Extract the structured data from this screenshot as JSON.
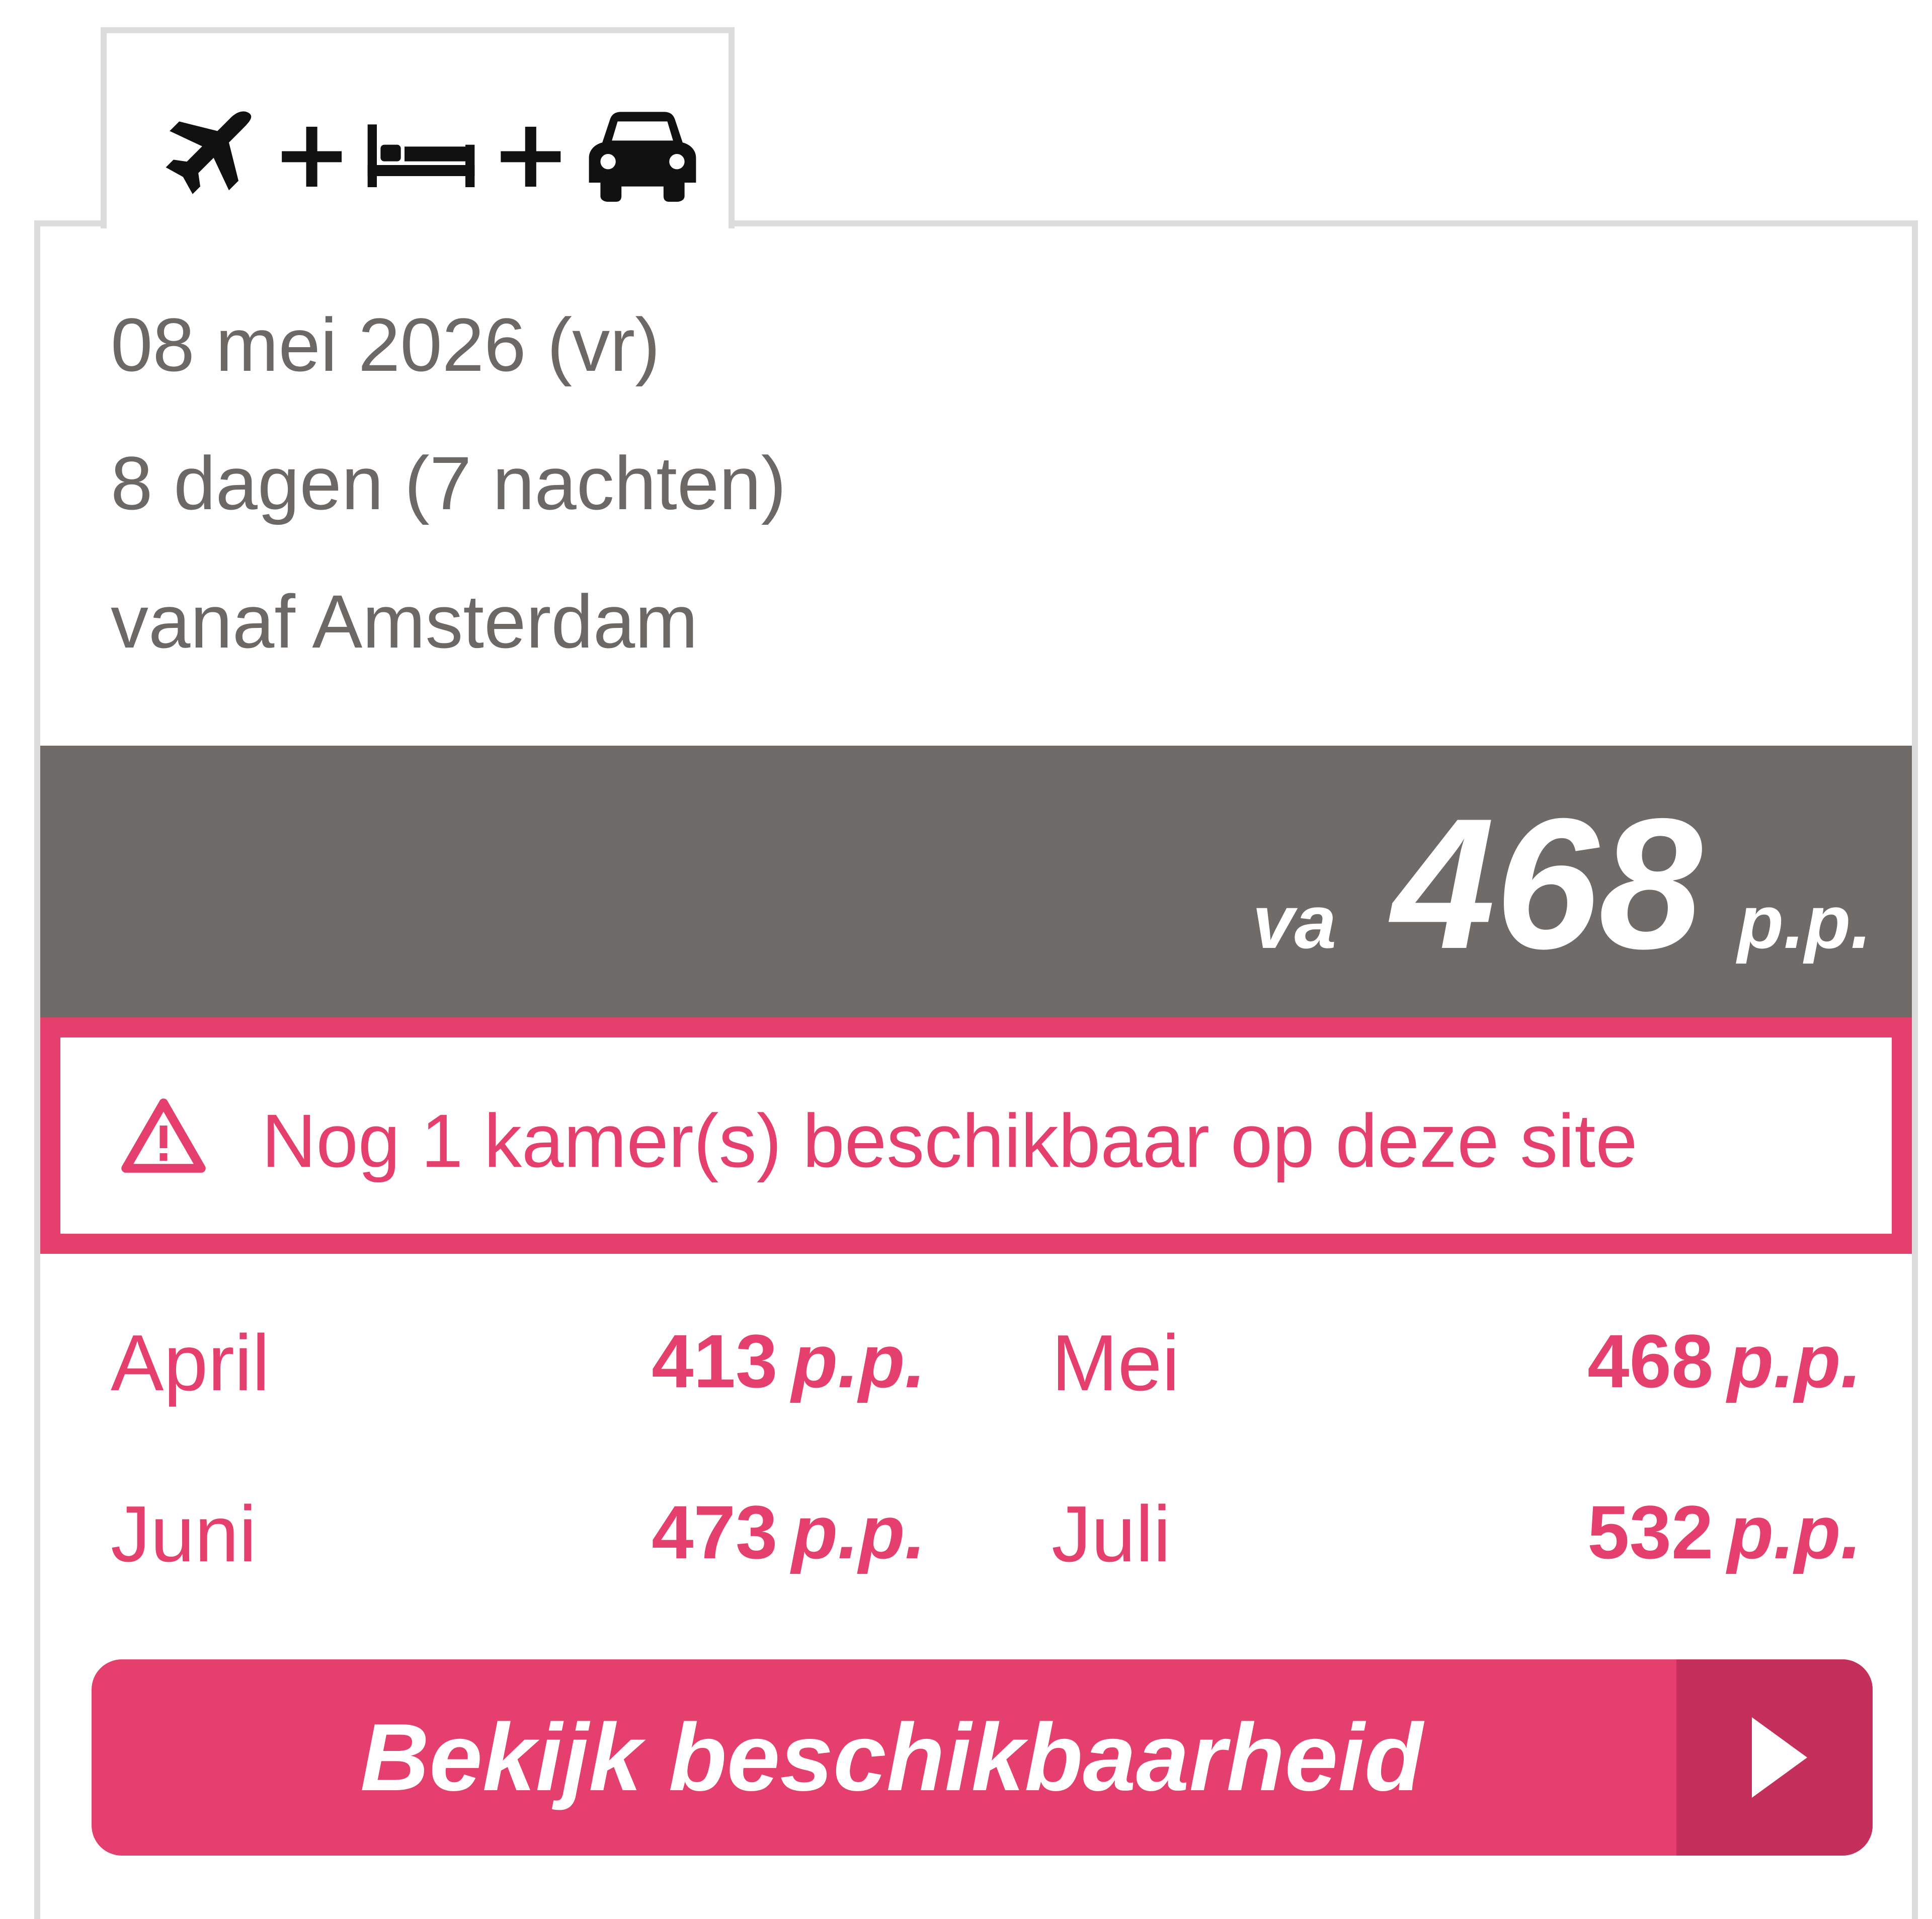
{
  "tab": {
    "icons": [
      "airplane-icon",
      "bed-icon",
      "car-icon"
    ],
    "separator": "+"
  },
  "trip": {
    "date": "08 mei 2026 (vr)",
    "duration": "8 dagen (7 nachten)",
    "origin": "vanaf Amsterdam"
  },
  "price": {
    "prefix": "va",
    "amount": "468",
    "suffix": "p.p."
  },
  "warning": {
    "icon": "warning-triangle-icon",
    "text": "Nog 1 kamer(s) beschikbaar op deze site"
  },
  "months": [
    {
      "name": "April",
      "price": "413",
      "unit": "p.p."
    },
    {
      "name": "Mei",
      "price": "468",
      "unit": "p.p."
    },
    {
      "name": "Juni",
      "price": "473",
      "unit": "p.p."
    },
    {
      "name": "Juli",
      "price": "532",
      "unit": "p.p."
    }
  ],
  "cta": {
    "label": "Bekijk beschikbaarheid",
    "icon": "play-arrow-icon"
  },
  "colors": {
    "accent": "#e53f6e",
    "accent_dark": "#c4305b",
    "price_bar": "#6f6b68",
    "text_muted": "#6b6866",
    "border": "#dcdcdc"
  }
}
